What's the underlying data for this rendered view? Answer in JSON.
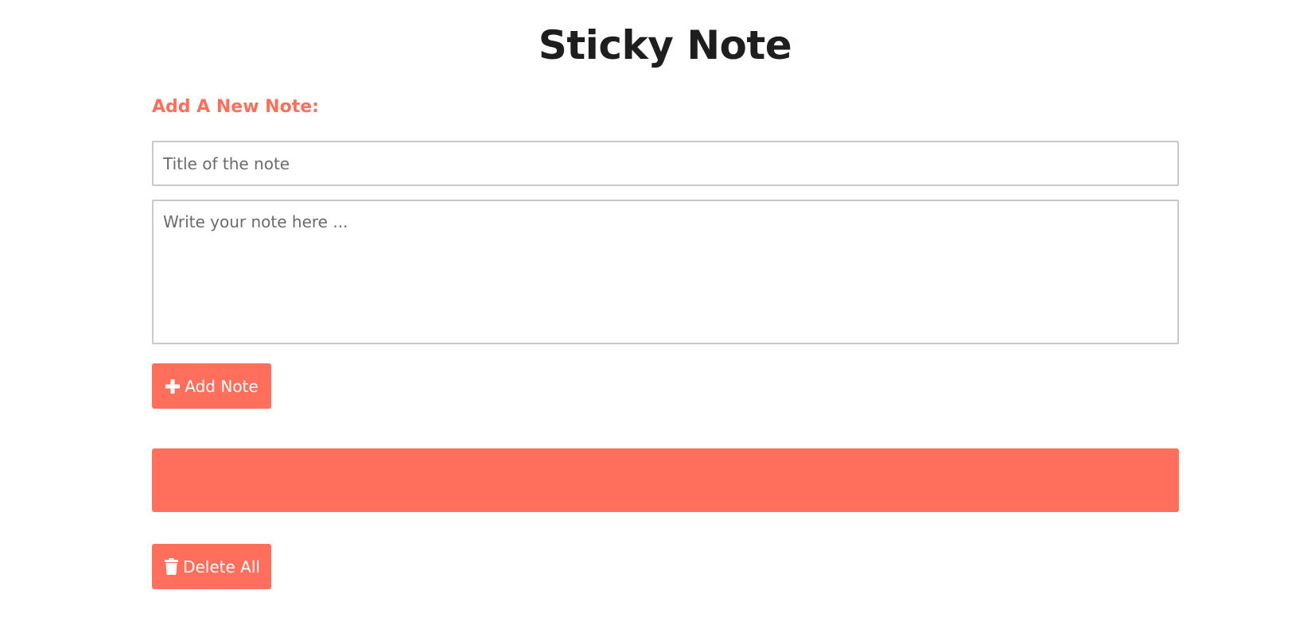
{
  "page": {
    "title": "Sticky Note"
  },
  "form": {
    "heading": "Add A New Note:",
    "title_placeholder": "Title of the note",
    "title_value": "",
    "note_placeholder": "Write your note here ...",
    "note_value": "",
    "add_button_label": "Add Note",
    "add_button_icon": "plus-icon"
  },
  "notes": {
    "items": []
  },
  "actions": {
    "delete_all_label": "Delete All",
    "delete_all_icon": "trash-icon"
  },
  "colors": {
    "accent": "#ff6f5b",
    "title_text": "#1e1e1e",
    "input_border": "#c9c9c9"
  }
}
